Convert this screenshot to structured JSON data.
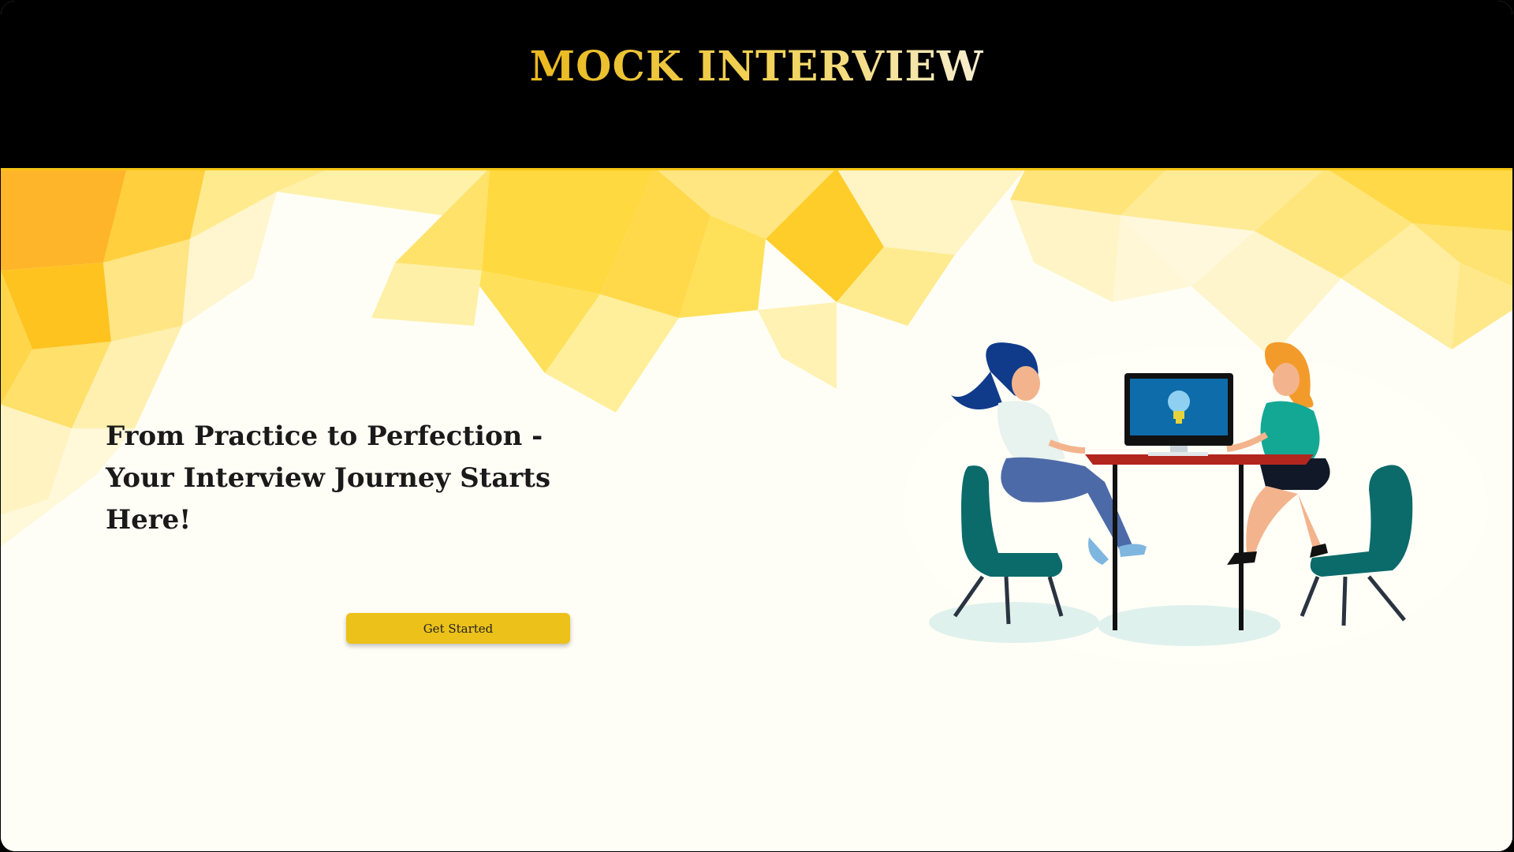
{
  "header": {
    "title": "MOCK INTERVIEW"
  },
  "hero": {
    "tagline": "From Practice to Perfection - Your Interview Journey Starts Here!",
    "cta_label": "Get Started"
  },
  "illustration": {
    "subject": "two-women-at-desk-with-computer-icon"
  },
  "colors": {
    "header_bg": "#000000",
    "title_gold": "#F1C21A",
    "button_bg": "#ECC119",
    "page_bg": "#FFFEF6"
  }
}
